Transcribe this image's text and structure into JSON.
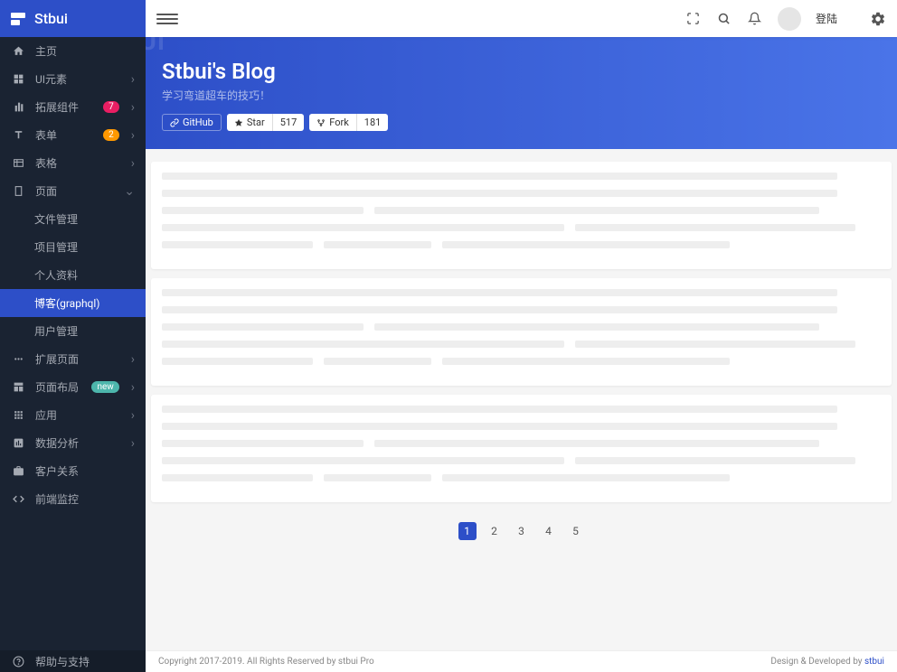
{
  "brand": "Stbui",
  "watermark": "STBUI",
  "sidebar": {
    "items": [
      {
        "icon": "home",
        "label": "主页",
        "arrow": false
      },
      {
        "icon": "widgets",
        "label": "UI元素",
        "arrow": true
      },
      {
        "icon": "bar",
        "label": "拓展组件",
        "arrow": true,
        "badge": "7",
        "badgeColor": "pink"
      },
      {
        "icon": "text",
        "label": "表单",
        "arrow": true,
        "badge": "2",
        "badgeColor": "orange"
      },
      {
        "icon": "table",
        "label": "表格",
        "arrow": true
      },
      {
        "icon": "page",
        "label": "页面",
        "arrow": true,
        "expanded": true
      }
    ],
    "subitems": [
      {
        "label": "文件管理"
      },
      {
        "label": "项目管理"
      },
      {
        "label": "个人资料"
      },
      {
        "label": "博客(graphql)",
        "active": true
      },
      {
        "label": "用户管理"
      }
    ],
    "items2": [
      {
        "icon": "dots",
        "label": "扩展页面",
        "arrow": true
      },
      {
        "icon": "layout",
        "label": "页面布局",
        "arrow": true,
        "badge": "new",
        "badgeColor": "teal"
      },
      {
        "icon": "apps",
        "label": "应用",
        "arrow": true
      },
      {
        "icon": "chart",
        "label": "数据分析",
        "arrow": true
      },
      {
        "icon": "briefcase",
        "label": "客户关系"
      },
      {
        "icon": "code",
        "label": "前端监控"
      }
    ],
    "footer": {
      "label": "帮助与支持"
    }
  },
  "topbar": {
    "login": "登陆"
  },
  "header": {
    "title": "Stbui's Blog",
    "subtitle": "学习弯道超车的技巧！",
    "github_label": "GitHub",
    "star_label": "Star",
    "star_count": "517",
    "fork_label": "Fork",
    "fork_count": "181"
  },
  "pagination": {
    "pages": [
      "1",
      "2",
      "3",
      "4",
      "5"
    ],
    "active": 0
  },
  "footer": {
    "copyright": "Copyright 2017-2019. All Rights Reserved by stbui Pro",
    "design_prefix": "Design & Developed by ",
    "design_link": "stbui"
  }
}
